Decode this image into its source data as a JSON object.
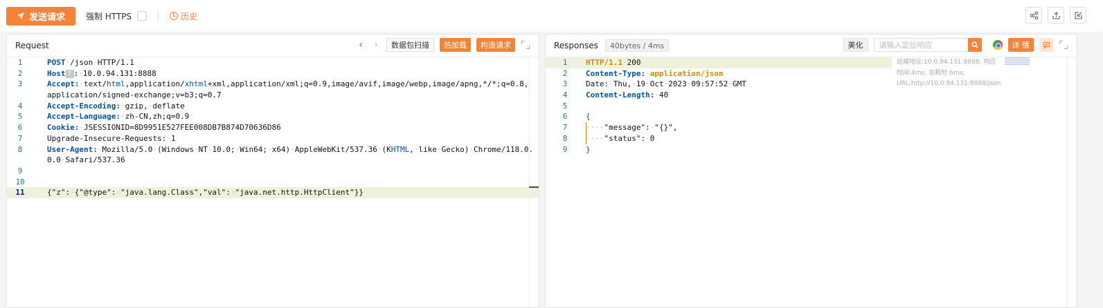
{
  "toolbar": {
    "send_label": "发送请求",
    "force_https_label": "强制 HTTPS",
    "history_label": "历史"
  },
  "request": {
    "title": "Request",
    "scan_label": "数据包扫描",
    "hot_load_label": "热加载",
    "build_label": "构造请求",
    "lines": [
      {
        "n": "1",
        "parts": [
          [
            "k",
            "POST"
          ],
          [
            "ws",
            "·"
          ],
          [
            "",
            "/json"
          ],
          [
            "ws",
            "·"
          ],
          [
            "",
            "HTTP/1.1"
          ]
        ]
      },
      {
        "n": "2",
        "parts": [
          [
            "k",
            "Host"
          ],
          [
            "q",
            "?"
          ],
          [
            "k",
            ":"
          ],
          [
            "ws",
            "·"
          ],
          [
            "",
            "10.0.94.131:8888"
          ]
        ]
      },
      {
        "n": "3",
        "parts": [
          [
            "k",
            "Accept:"
          ],
          [
            "ws",
            "·"
          ],
          [
            "",
            "text/"
          ],
          [
            "u",
            "html"
          ],
          [
            "",
            ",application/"
          ],
          [
            "u",
            "xhtml"
          ],
          [
            "",
            "+xml,application/xml;q=0.9,image/avif,image/webp,image/apng,*/*;q=0.8,"
          ]
        ]
      },
      {
        "n": "",
        "parts": [
          [
            "",
            "application/signed-exchange;v=b3;q=0.7"
          ]
        ]
      },
      {
        "n": "4",
        "parts": [
          [
            "k",
            "Accept-Encoding:"
          ],
          [
            "ws",
            "·"
          ],
          [
            "",
            "gzip,"
          ],
          [
            "ws",
            "·"
          ],
          [
            "",
            "deflate"
          ]
        ]
      },
      {
        "n": "5",
        "parts": [
          [
            "k",
            "Accept-Language:"
          ],
          [
            "ws",
            "·"
          ],
          [
            "",
            "zh-CN,zh;q=0.9"
          ]
        ]
      },
      {
        "n": "6",
        "parts": [
          [
            "k",
            "Cookie:"
          ],
          [
            "ws",
            "·"
          ],
          [
            "",
            "JSESSIONID=8D9951E527FEE008DB7B874D70636D86"
          ]
        ]
      },
      {
        "n": "7",
        "parts": [
          [
            "",
            "Upgrade-Insecure-Requests:"
          ],
          [
            "ws",
            "·"
          ],
          [
            "",
            "1"
          ]
        ]
      },
      {
        "n": "8",
        "parts": [
          [
            "k",
            "User-Agent:"
          ],
          [
            "ws",
            "·"
          ],
          [
            "",
            "Mozilla/5.0"
          ],
          [
            "ws",
            "·"
          ],
          [
            "",
            "(Windows"
          ],
          [
            "ws",
            "·"
          ],
          [
            "",
            "NT"
          ],
          [
            "ws",
            "·"
          ],
          [
            "",
            "10.0;"
          ],
          [
            "ws",
            "·"
          ],
          [
            "",
            "Win64;"
          ],
          [
            "ws",
            "·"
          ],
          [
            "",
            "x64)"
          ],
          [
            "ws",
            "·"
          ],
          [
            "",
            "AppleWebKit/537.36"
          ],
          [
            "ws",
            "·"
          ],
          [
            "",
            "(K"
          ],
          [
            "u",
            "HTML"
          ],
          [
            "",
            ","
          ],
          [
            "ws",
            "·"
          ],
          [
            "",
            "like"
          ],
          [
            "ws",
            "·"
          ],
          [
            "",
            "Gecko)"
          ],
          [
            "ws",
            "·"
          ],
          [
            "",
            "Chrome/118.0."
          ]
        ]
      },
      {
        "n": "",
        "parts": [
          [
            "",
            "0.0"
          ],
          [
            "ws",
            "·"
          ],
          [
            "",
            "Safari/537.36"
          ]
        ]
      },
      {
        "n": "9",
        "parts": []
      },
      {
        "n": "10",
        "parts": []
      },
      {
        "n": "11",
        "cur": true,
        "parts": [
          [
            "",
            "{\"z\":"
          ],
          [
            "ws",
            "·"
          ],
          [
            "",
            "{\"@type\":"
          ],
          [
            "ws",
            "·"
          ],
          [
            "",
            "\"java.lang.Class\",\"val\":"
          ],
          [
            "ws",
            "·"
          ],
          [
            "",
            "\"java.net.http.HttpClient\"}}"
          ]
        ]
      }
    ]
  },
  "response": {
    "title": "Responses",
    "size_badge": "40bytes / 4ms",
    "beautify_label": "美化",
    "search_placeholder": "请输入定位响应",
    "detail_label": "详 情",
    "meta_text": "远端地址:10.0.94.131:8888; 响应时间:4ms; 总耗时:6ms; URL:http://10.0.94.131:8888/json",
    "lines": [
      {
        "n": "1",
        "hl": true,
        "parts": [
          [
            "kt",
            "HTTP/1.1"
          ],
          [
            "ws",
            "·"
          ],
          [
            "",
            "200"
          ]
        ]
      },
      {
        "n": "2",
        "parts": [
          [
            "k",
            "Content-Type:"
          ],
          [
            "ws",
            "·"
          ],
          [
            "kt",
            "application/json"
          ]
        ]
      },
      {
        "n": "3",
        "parts": [
          [
            "",
            "Date:"
          ],
          [
            "ws",
            "·"
          ],
          [
            "",
            "Thu,"
          ],
          [
            "ws",
            "·"
          ],
          [
            "",
            "19"
          ],
          [
            "ws",
            "·"
          ],
          [
            "",
            "Oct"
          ],
          [
            "ws",
            "·"
          ],
          [
            "",
            "2023"
          ],
          [
            "ws",
            "·"
          ],
          [
            "",
            "09:57:52"
          ],
          [
            "ws",
            "·"
          ],
          [
            "",
            "GMT"
          ]
        ]
      },
      {
        "n": "4",
        "parts": [
          [
            "k",
            "Content-Length:"
          ],
          [
            "ws",
            "·"
          ],
          [
            "",
            "40"
          ]
        ]
      },
      {
        "n": "5",
        "parts": []
      },
      {
        "n": "6",
        "parts": [
          [
            "u",
            "{"
          ]
        ]
      },
      {
        "n": "7",
        "parts": [
          [
            "ws",
            "····"
          ],
          [
            "",
            "\"message\":"
          ],
          [
            "ws",
            "·"
          ],
          [
            "",
            "\"{}\","
          ]
        ]
      },
      {
        "n": "8",
        "parts": [
          [
            "ws",
            "····"
          ],
          [
            "",
            "\"status\":"
          ],
          [
            "ws",
            "·"
          ],
          [
            "",
            "0"
          ]
        ]
      },
      {
        "n": "9",
        "parts": [
          [
            "u",
            "}"
          ]
        ]
      }
    ]
  },
  "colors": {
    "accent": "#f5843a",
    "keyword": "#0451a5",
    "status": "#d78a00"
  },
  "icons": [
    "paper-plane-icon",
    "clock-icon",
    "share-icon",
    "export-icon",
    "import-icon",
    "chevron-left-icon",
    "chevron-right-icon",
    "expand-icon",
    "search-icon",
    "chrome-icon",
    "comment-icon"
  ]
}
